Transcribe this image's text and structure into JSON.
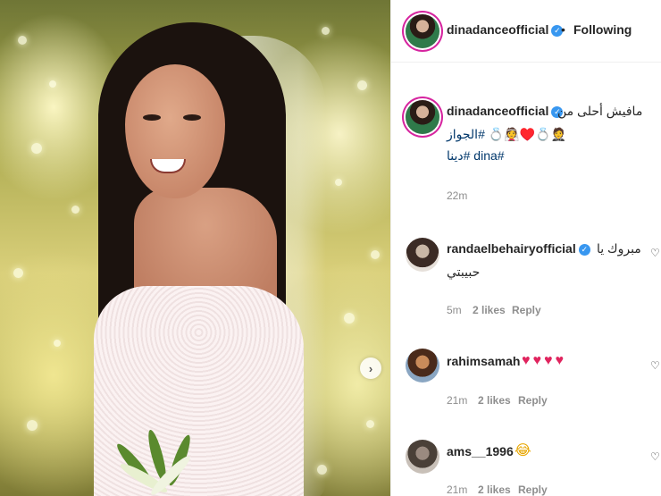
{
  "post": {
    "author": "dinadanceofficial",
    "follow_state": "Following",
    "separator": "•",
    "caption_line1": "مافيش أحلى من",
    "caption_emojis": "🤵💍♥️👰💍 #الجواز",
    "hashtags": "#dina #دينا",
    "time": "22m"
  },
  "comments": [
    {
      "user": "randaelbehairyofficial",
      "verified": true,
      "text_line1": "مبروك يا",
      "text_line2": "حبيبتي",
      "time": "5m",
      "likes": "2 likes",
      "reply": "Reply"
    },
    {
      "user": "rahimsamah",
      "verified": false,
      "text_line1": "♥♥♥♥",
      "time": "21m",
      "likes": "2 likes",
      "reply": "Reply"
    },
    {
      "user": "ams__1996",
      "verified": false,
      "text_line1": "😂",
      "time": "21m",
      "likes": "2 likes",
      "reply": "Reply"
    }
  ],
  "icons": {
    "verified": "✓",
    "carousel_next": "›",
    "like_small": "♡"
  },
  "colors": {
    "link_blue": "#00376b",
    "verified_blue": "#3897f0",
    "muted_grey": "#8e8e8e"
  }
}
